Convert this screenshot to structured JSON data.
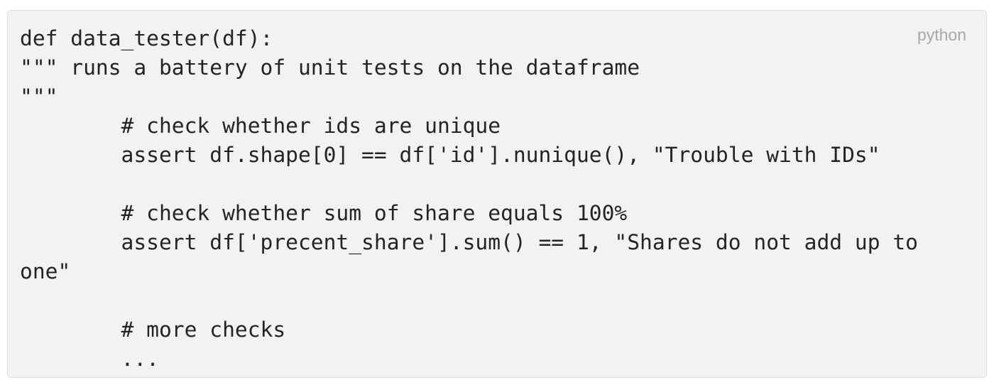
{
  "code_block": {
    "language_label": "python",
    "lines": [
      "def data_tester(df):",
      "\"\"\" runs a battery of unit tests on the dataframe",
      "\"\"\"",
      "        # check whether ids are unique",
      "        assert df.shape[0] == df['id'].nunique(), \"Trouble with IDs\"",
      "",
      "        # check whether sum of share equals 100%",
      "        assert df['precent_share'].sum() == 1, \"Shares do not add up to",
      "one\"",
      "",
      "        # more checks",
      "        ..."
    ]
  }
}
